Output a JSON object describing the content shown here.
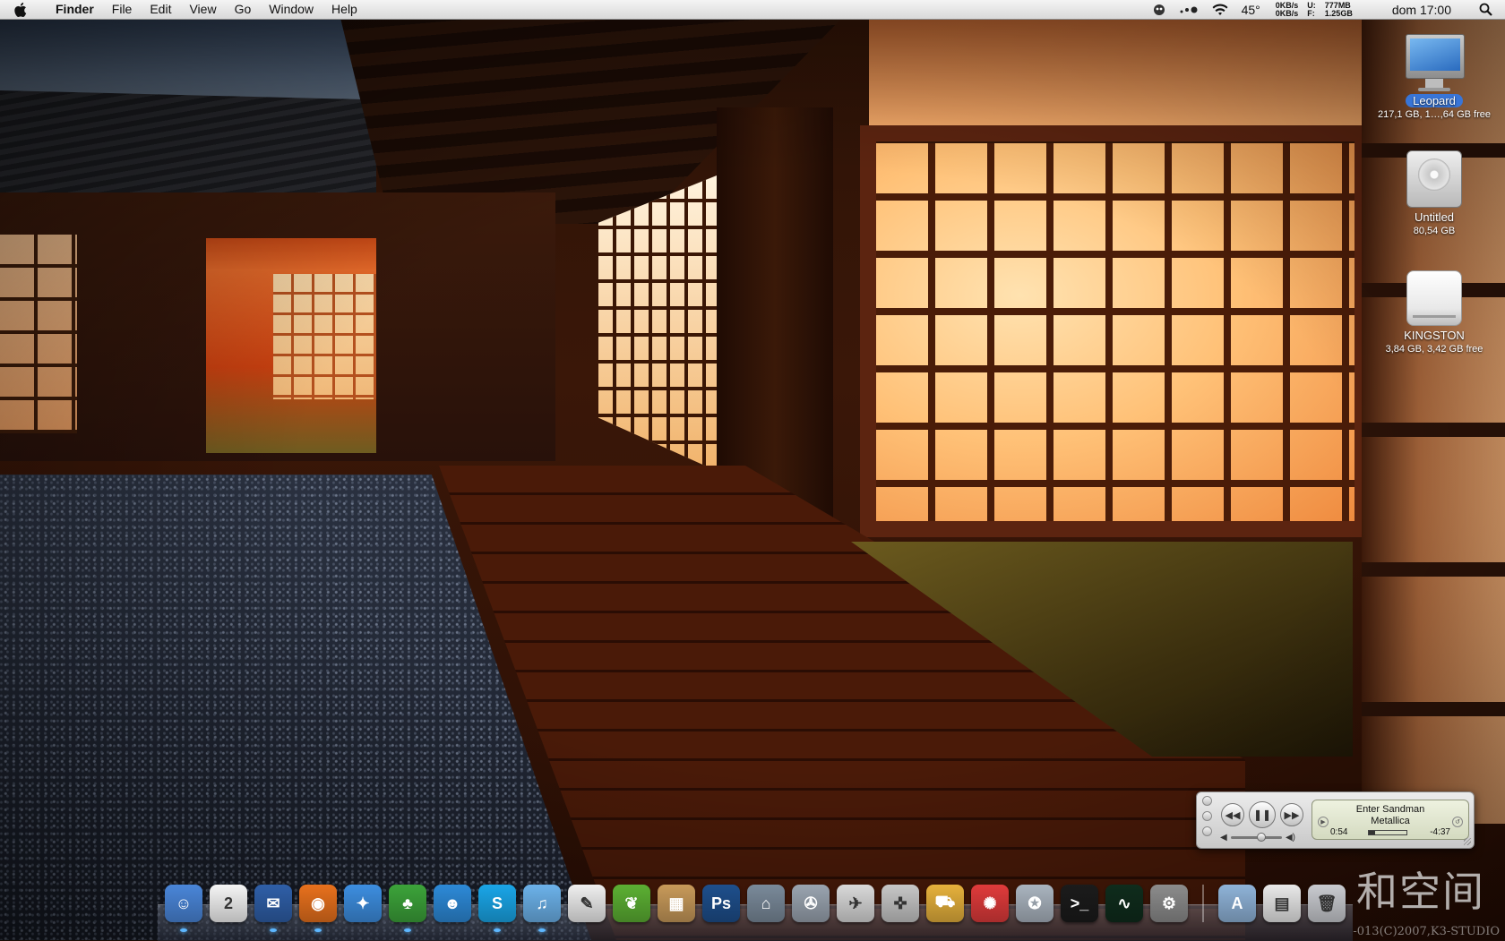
{
  "menubar": {
    "app_name": "Finder",
    "menus": [
      "File",
      "Edit",
      "View",
      "Go",
      "Window",
      "Help"
    ],
    "temperature": "45°",
    "net": {
      "down": "0KB/s",
      "up": "0KB/s"
    },
    "memory": {
      "used_label": "U:",
      "used": "777MB",
      "free_label": "F:",
      "free": "1.25GB"
    },
    "clock": "dom 17:00"
  },
  "desktop": {
    "items": [
      {
        "name": "Leopard",
        "info": "217,1 GB, 1…,64 GB free",
        "icon": "imac-icon",
        "selected": true
      },
      {
        "name": "Untitled",
        "info": "80,54 GB",
        "icon": "hard-drive-icon"
      },
      {
        "name": "KINGSTON",
        "info": "3,84 GB, 3,42 GB free",
        "icon": "external-drive-icon"
      }
    ]
  },
  "itunes": {
    "track": "Enter Sandman",
    "artist": "Metallica",
    "elapsed": "0:54",
    "remaining": "-4:37",
    "progress": 0.16,
    "volume": 0.6
  },
  "dock": {
    "apps": [
      {
        "name": "Finder",
        "icon": "finder-icon",
        "color": "#4a86d9",
        "glyph": "☺",
        "running": true
      },
      {
        "name": "iCal",
        "icon": "calendar-icon",
        "color": "#f5f5f5",
        "glyph": "2",
        "running": false
      },
      {
        "name": "Thunderbird",
        "icon": "thunderbird-icon",
        "color": "#2f5fa8",
        "glyph": "✉",
        "running": true
      },
      {
        "name": "Firefox",
        "icon": "firefox-icon",
        "color": "#e8711d",
        "glyph": "◉",
        "running": true
      },
      {
        "name": "Safari",
        "icon": "safari-icon",
        "color": "#3d8ee0",
        "glyph": "✦",
        "running": false
      },
      {
        "name": "Adium",
        "icon": "adium-icon",
        "color": "#3ca33a",
        "glyph": "♣",
        "running": true
      },
      {
        "name": "Messenger",
        "icon": "messenger-icon",
        "color": "#2d8ad8",
        "glyph": "☻",
        "running": false
      },
      {
        "name": "Skype",
        "icon": "skype-icon",
        "color": "#1aa6e8",
        "glyph": "S",
        "running": true
      },
      {
        "name": "iTunes",
        "icon": "itunes-icon",
        "color": "#6cb2ea",
        "glyph": "♫",
        "running": true
      },
      {
        "name": "TextEdit",
        "icon": "textedit-icon",
        "color": "#efefef",
        "glyph": "✎",
        "running": false
      },
      {
        "name": "Leaf",
        "icon": "leaf-icon",
        "color": "#5cb033",
        "glyph": "❦",
        "running": false
      },
      {
        "name": "Preview",
        "icon": "preview-icon",
        "color": "#c89a5a",
        "glyph": "▦",
        "running": false
      },
      {
        "name": "Photoshop",
        "icon": "photoshop-icon",
        "color": "#1e4f8c",
        "glyph": "Ps",
        "running": false
      },
      {
        "name": "Wishing Well",
        "icon": "wishing-well-icon",
        "color": "#7a8a9a",
        "glyph": "⌂",
        "running": false
      },
      {
        "name": "iMovie",
        "icon": "imovie-icon",
        "color": "#9aa4b0",
        "glyph": "✇",
        "running": false
      },
      {
        "name": "Toast",
        "icon": "toast-icon",
        "color": "#d9d9d9",
        "glyph": "✈",
        "running": false
      },
      {
        "name": "Joystick",
        "icon": "joystick-icon",
        "color": "#c7c7c7",
        "glyph": "✜",
        "running": false
      },
      {
        "name": "Transmit",
        "icon": "transmit-icon",
        "color": "#e6b13c",
        "glyph": "⛟",
        "running": false
      },
      {
        "name": "Ray Gun",
        "icon": "raygun-icon",
        "color": "#e03b3b",
        "glyph": "✺",
        "running": false
      },
      {
        "name": "Remote Desktop",
        "icon": "remote-desktop-icon",
        "color": "#aab4bf",
        "glyph": "✪",
        "running": false
      },
      {
        "name": "Terminal",
        "icon": "terminal-icon",
        "color": "#1b1b1b",
        "glyph": ">_",
        "running": false
      },
      {
        "name": "Activity Monitor",
        "icon": "activity-monitor-icon",
        "color": "#0f2c1c",
        "glyph": "∿",
        "running": false
      },
      {
        "name": "System Preferences",
        "icon": "gear-icon",
        "color": "#8c8c8c",
        "glyph": "⚙",
        "running": false
      }
    ],
    "docs": [
      {
        "name": "Applications",
        "icon": "applications-folder-icon",
        "color": "#8fb3d8",
        "glyph": "A"
      },
      {
        "name": "Downloads",
        "icon": "downloads-stack-icon",
        "color": "#e9e9e9",
        "glyph": "▤"
      },
      {
        "name": "Trash",
        "icon": "trash-icon",
        "color": "#c9cbd0",
        "glyph": "🗑"
      }
    ]
  },
  "wallpaper": {
    "watermark": "和空间",
    "copyright": "-013(C)2007,K3-STUDIO"
  }
}
